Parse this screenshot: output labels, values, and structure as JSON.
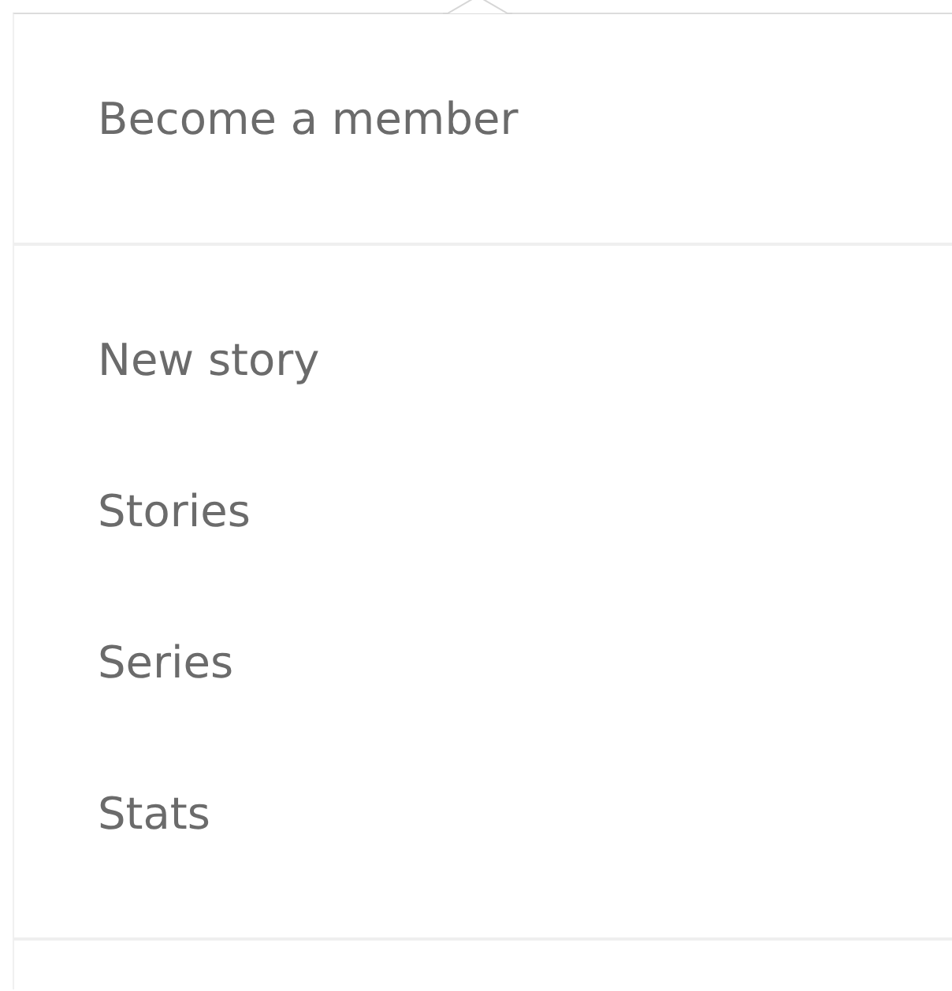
{
  "menu": {
    "sections": [
      {
        "items": [
          {
            "label": "Become a member"
          }
        ]
      },
      {
        "items": [
          {
            "label": "New story"
          },
          {
            "label": "Stories"
          },
          {
            "label": "Series"
          },
          {
            "label": "Stats"
          }
        ]
      }
    ]
  }
}
